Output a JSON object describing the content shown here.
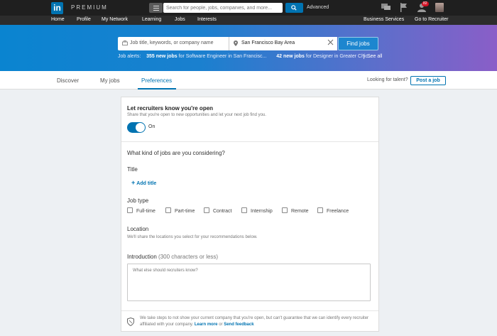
{
  "topbar": {
    "logo_text": "in",
    "premium_label": "PREMIUM",
    "search_placeholder": "Search for people, jobs, companies, and more...",
    "advanced_label": "Advanced",
    "notification_count": "82"
  },
  "nav": {
    "items": [
      "Home",
      "Profile",
      "My Network",
      "Learning",
      "Jobs",
      "Interests"
    ],
    "business_services": "Business Services",
    "go_to_recruiter": "Go to Recruiter"
  },
  "hero": {
    "keyword_placeholder": "Job title, keywords, or company name",
    "location_value": "San Francisco Bay Area",
    "find_jobs_label": "Find jobs",
    "alerts_label": "Job alerts:",
    "alert1_count": "355 new jobs",
    "alert1_text": "for Software Engineer in San Francisc...",
    "alert2_count": "42 new jobs",
    "alert2_text": "for Designer in Greater Chic...",
    "see_all": "See all"
  },
  "tabs": {
    "items": [
      "Discover",
      "My jobs",
      "Preferences"
    ],
    "active": "Preferences",
    "talent_label": "Looking for talent?",
    "post_job_label": "Post a job"
  },
  "card": {
    "open_title": "Let recruiters know you're open",
    "open_subtitle": "Share that you're open to new opportunities and let your next job find you.",
    "toggle_label": "On",
    "jobs_question": "What kind of jobs are you considering?",
    "title_label": "Title",
    "add_title_label": "Add title",
    "job_type_label": "Job type",
    "job_types": [
      "Full-time",
      "Part-time",
      "Contract",
      "Internship",
      "Remote",
      "Freelance"
    ],
    "location_label": "Location",
    "location_note": "We'll share the locations you select for your recommendations below.",
    "intro_label": "Introduction",
    "intro_limit": "(300 characters or less)",
    "intro_placeholder": "What else should recruiters know?",
    "footer_text": "We take steps to not show your current company that you're open, but can't guarantee that we can identify every recruiter affiliated with your company.",
    "learn_more": "Learn more",
    "or_text": "or",
    "send_feedback": "Send feedback"
  }
}
